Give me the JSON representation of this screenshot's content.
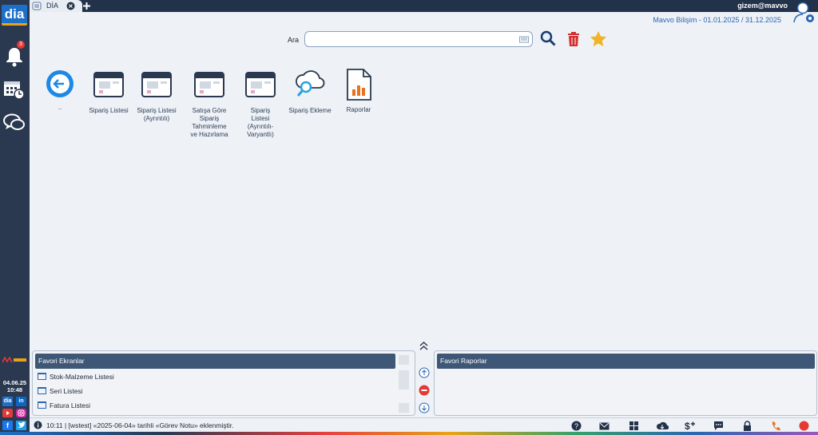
{
  "app": {
    "logo_text": "dia",
    "tab_label": "DİA"
  },
  "header": {
    "user": "gizem@mavvo",
    "company": "Mavvo Bilişim -",
    "period": "01.01.2025 / 31.12.2025"
  },
  "sidebar": {
    "notification_count": "3",
    "date": "04.06.25",
    "time": "10:48"
  },
  "search": {
    "label": "Ara",
    "value": ""
  },
  "tiles": [
    {
      "label": ".."
    },
    {
      "label": "Sipariş Listesi"
    },
    {
      "label": "Sipariş Listesi (Ayrıntılı)"
    },
    {
      "label": "Satışa Göre Sipariş Tahminleme ve Hazırlama"
    },
    {
      "label": "Sipariş Listesi (Ayrıntılı-Varyantlı)"
    },
    {
      "label": "Sipariş Ekleme"
    },
    {
      "label": "Raporlar"
    }
  ],
  "favorites": {
    "screens_title": "Favori Ekranlar",
    "screens": [
      "Stok-Malzeme Listesi",
      "Seri Listesi",
      "Fatura Listesi"
    ],
    "reports_title": "Favori Raporlar"
  },
  "status": {
    "message": "10:11 | [wstest] «2025-06-04» tarihli «Görev Notu» eklenmiştir."
  },
  "colors": {
    "sidebar": "#2a3950",
    "accent": "#1e6fc7",
    "panel_header": "#3e5777",
    "delete": "#d32f2f",
    "star": "#f0b429"
  }
}
